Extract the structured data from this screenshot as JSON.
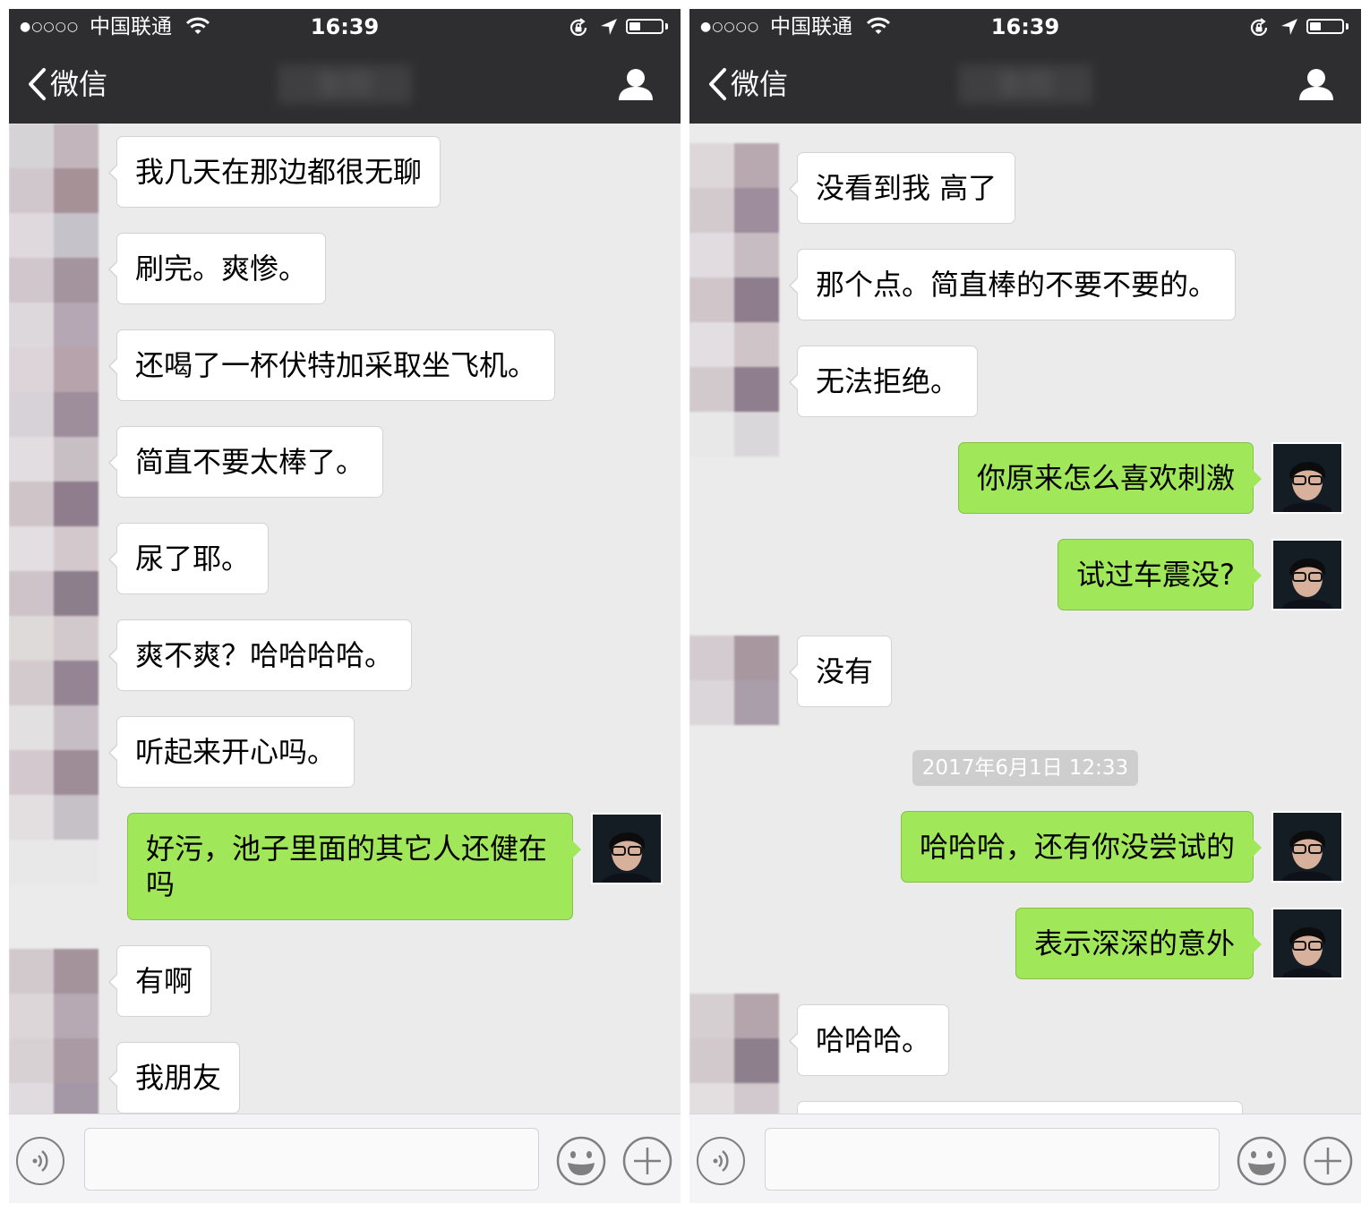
{
  "status_bar": {
    "signal": "●○○○○",
    "carrier": "中国联通",
    "time": "16:39",
    "battery_level": 0.35
  },
  "nav": {
    "back_label": "微信",
    "contact_name": "张欣"
  },
  "left_screen": {
    "messages": [
      {
        "dir": "in",
        "text": "我几天在那边都很无聊"
      },
      {
        "dir": "in",
        "text": "刷完。爽惨。"
      },
      {
        "dir": "in",
        "text": "还喝了一杯伏特加采取坐飞机。"
      },
      {
        "dir": "in",
        "text": "简直不要太棒了。"
      },
      {
        "dir": "in",
        "text": "尿了耶。"
      },
      {
        "dir": "in",
        "text": "爽不爽？哈哈哈哈。"
      },
      {
        "dir": "in",
        "text": "听起来开心吗。"
      },
      {
        "dir": "out",
        "text": "好污，池子里面的其它人还健在吗"
      },
      {
        "dir": "in",
        "text": "有啊"
      },
      {
        "dir": "in",
        "text": "我朋友"
      }
    ]
  },
  "right_screen": {
    "messages": [
      {
        "dir": "in",
        "text": "没看到我 高了"
      },
      {
        "dir": "in",
        "text": "那个点。简直棒的不要不要的。"
      },
      {
        "dir": "in",
        "text": "无法拒绝。"
      },
      {
        "dir": "out",
        "text": "你原来怎么喜欢刺激"
      },
      {
        "dir": "out",
        "text": "试过车震没?"
      },
      {
        "dir": "in",
        "text": "没有"
      },
      {
        "dir": "out",
        "text": "哈哈哈，还有你没尝试的"
      },
      {
        "dir": "out",
        "text": "表示深深的意外"
      },
      {
        "dir": "in",
        "text": "哈哈哈。"
      }
    ],
    "timestamp": "2017年6月1日 12:33"
  },
  "colors": {
    "nav_background": "#2e2e30",
    "chat_background": "#ebebeb",
    "outgoing_bubble": "#a0e75a",
    "incoming_bubble": "#ffffff",
    "timestamp_pill": "#cecece"
  },
  "icons": {
    "back": "chevron-left-icon",
    "profile": "person-icon",
    "wifi": "wifi-icon",
    "rotation_lock": "rotation-lock-icon",
    "location": "location-arrow-icon",
    "voice": "voice-icon",
    "emoji": "emoji-icon",
    "more": "plus-icon"
  }
}
